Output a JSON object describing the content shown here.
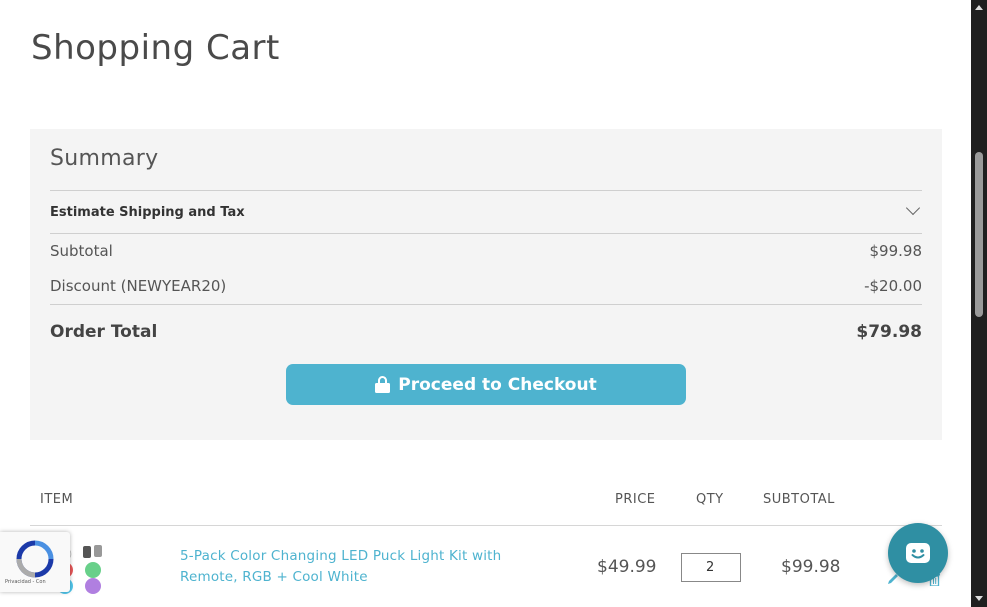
{
  "page": {
    "title": "Shopping Cart"
  },
  "summary": {
    "title": "Summary",
    "estimate_label": "Estimate Shipping and Tax",
    "subtotal_label": "Subtotal",
    "subtotal_value": "$99.98",
    "discount_label": "Discount (NEWYEAR20)",
    "discount_value": "-$20.00",
    "total_label": "Order Total",
    "total_value": "$79.98",
    "checkout_label": "Proceed to Checkout"
  },
  "table": {
    "headers": {
      "item": "ITEM",
      "price": "PRICE",
      "qty": "QTY",
      "subtotal": "SUBTOTAL"
    },
    "rows": [
      {
        "name": "5-Pack Color Changing LED Puck Light Kit with Remote, RGB + Cool White",
        "price": "$49.99",
        "qty": "2",
        "subtotal": "$99.98"
      }
    ]
  },
  "recaptcha": {
    "text": "Privacidad - Con"
  },
  "colors": {
    "accent": "#4eb3cf",
    "chat": "#2f8fa3",
    "summary_bg": "#f4f4f4"
  },
  "icons": [
    "lock-icon",
    "chevron-down-icon",
    "edit-icon",
    "delete-icon",
    "chat-icon",
    "recaptcha-icon"
  ]
}
